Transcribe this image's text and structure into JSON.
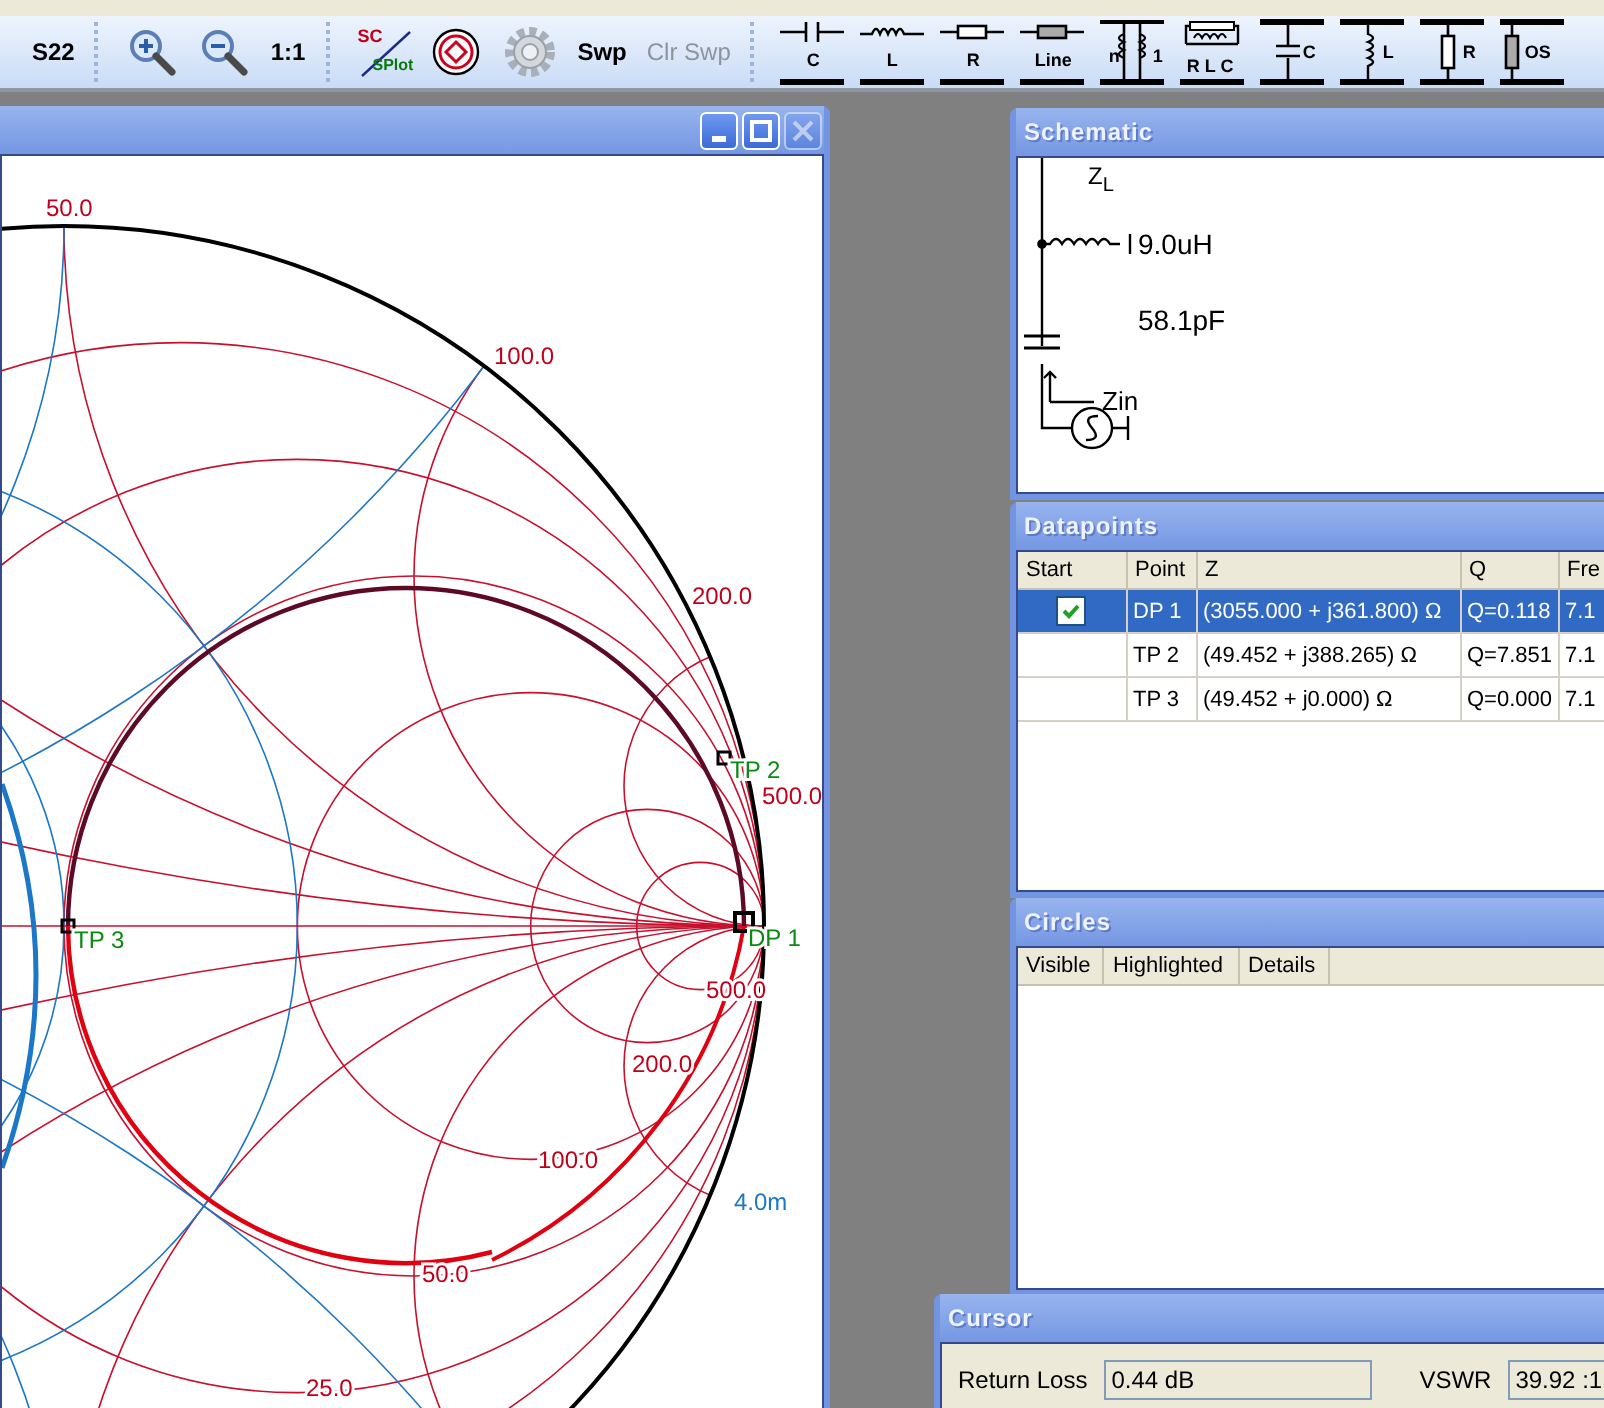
{
  "toolbar": {
    "groups": [
      [
        {
          "kind": "text",
          "label": "S22",
          "disabled": false
        }
      ],
      [
        {
          "kind": "zoom_in",
          "disabled": false
        },
        {
          "kind": "zoom_out",
          "disabled": false
        },
        {
          "kind": "text",
          "label": "1:1",
          "disabled": false
        }
      ],
      [
        {
          "kind": "sc_splot",
          "label": "SC",
          "label_2": "SPlot",
          "disabled": false
        },
        {
          "kind": "target",
          "disabled": false
        },
        {
          "kind": "gear",
          "disabled": false
        },
        {
          "kind": "text",
          "label": "Swp",
          "disabled": false
        },
        {
          "kind": "text",
          "label": "Clr Swp",
          "disabled": true
        }
      ],
      [
        {
          "kind": "series_c",
          "label": "C",
          "disabled": false
        },
        {
          "kind": "series_l",
          "label": "L",
          "disabled": false
        },
        {
          "kind": "series_r",
          "label": "R",
          "disabled": false
        },
        {
          "kind": "series_line",
          "label": "Line",
          "disabled": false
        },
        {
          "kind": "transformer",
          "label": "n",
          "label_2": "1",
          "disabled": false
        },
        {
          "kind": "rlc",
          "label": "R L C",
          "disabled": false
        },
        {
          "kind": "shunt_c",
          "label": "C",
          "disabled": false
        },
        {
          "kind": "shunt_l",
          "label": "L",
          "disabled": false
        },
        {
          "kind": "shunt_r",
          "label": "R",
          "disabled": false
        },
        {
          "kind": "shunt_os",
          "label": "OS",
          "disabled": false
        }
      ]
    ]
  },
  "smith_window": {
    "close_disabled": true,
    "labels": [
      {
        "text": "50.0",
        "kind": "resistance"
      },
      {
        "text": "100.0",
        "kind": "resistance"
      },
      {
        "text": "200.0",
        "kind": "resistance"
      },
      {
        "text": "500.0",
        "kind": "resistance"
      },
      {
        "text": "500.0",
        "kind": "resistance"
      },
      {
        "text": "200.0",
        "kind": "resistance"
      },
      {
        "text": "100.0",
        "kind": "resistance"
      },
      {
        "text": "50.0",
        "kind": "resistance"
      },
      {
        "text": "25.0",
        "kind": "resistance"
      },
      {
        "text": "4.0m",
        "kind": "admittance"
      }
    ],
    "points": [
      {
        "label": "DP 1"
      },
      {
        "label": "TP 2"
      },
      {
        "label": "TP 3"
      }
    ]
  },
  "schematic": {
    "title": "Schematic",
    "load": "Z$_{L}$",
    "inductor": "9.0uH",
    "capacitor": "58.1pF",
    "input": "Zin"
  },
  "datapoints": {
    "title": "Datapoints",
    "columns": [
      "Start",
      "Point",
      "Z",
      "Q",
      "Fre"
    ],
    "rows": [
      {
        "selected": true,
        "checked": true,
        "point": "DP 1",
        "z": "(3055.000 + j361.800) Ω",
        "q": "Q=0.118",
        "freq": "7.1"
      },
      {
        "selected": false,
        "checked": false,
        "point": "TP 2",
        "z": "(49.452 + j388.265) Ω",
        "q": "Q=7.851",
        "freq": "7.1"
      },
      {
        "selected": false,
        "checked": false,
        "point": "TP 3",
        "z": "(49.452 + j0.000) Ω",
        "q": "Q=0.000",
        "freq": "7.1"
      }
    ]
  },
  "circles": {
    "title": "Circles",
    "columns": [
      "Visible",
      "Highlighted",
      "Details"
    ]
  },
  "cursor": {
    "title": "Cursor",
    "fields": [
      {
        "label": "Return Loss",
        "value": "0.44 dB"
      },
      {
        "label": "VSWR",
        "value": "39.92 :1"
      }
    ]
  }
}
